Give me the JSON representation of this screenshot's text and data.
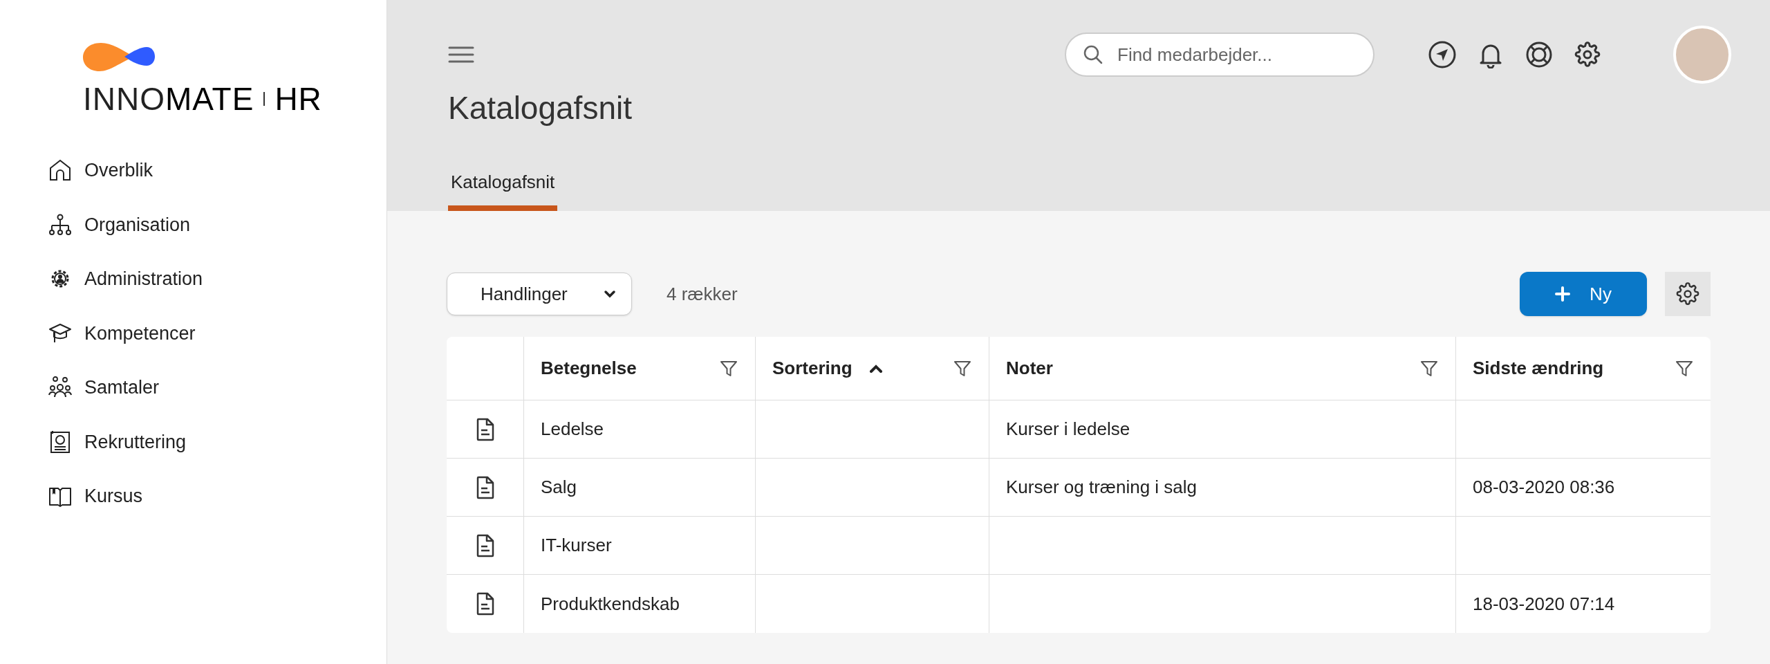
{
  "logo": {
    "left": "INNO",
    "right": "MATE",
    "suffix": "HR"
  },
  "sidebar": {
    "items": [
      {
        "label": "Overblik",
        "kind": "home"
      },
      {
        "label": "Organisation",
        "kind": "org"
      },
      {
        "label": "Administration",
        "kind": "admin"
      },
      {
        "label": "Kompetencer",
        "kind": "cap"
      },
      {
        "label": "Samtaler",
        "kind": "people"
      },
      {
        "label": "Rekruttering",
        "kind": "badge"
      },
      {
        "label": "Kursus",
        "kind": "book"
      }
    ]
  },
  "header": {
    "search": {
      "placeholder": "Find medarbejder..."
    },
    "title": "Katalogafsnit",
    "tabs": [
      {
        "label": "Katalogafsnit",
        "selected": true
      }
    ]
  },
  "toolbar": {
    "actions": "Handlinger",
    "count": "4 rækker",
    "new": "Ny"
  },
  "table": {
    "columns": [
      {
        "label": "Betegnelse",
        "sorted": false
      },
      {
        "label": "Sortering",
        "sorted": true
      },
      {
        "label": "Noter",
        "sorted": false
      },
      {
        "label": "Sidste ændring",
        "sorted": false
      }
    ],
    "rows": [
      [
        "Ledelse",
        "",
        "Kurser i ledelse",
        ""
      ],
      [
        "Salg",
        "",
        "Kurser og træning i salg",
        "08-03-2020 08:36"
      ],
      [
        "IT-kurser",
        "",
        "",
        ""
      ],
      [
        "Produktkendskab",
        "",
        "",
        "18-03-2020 07:14"
      ]
    ]
  }
}
